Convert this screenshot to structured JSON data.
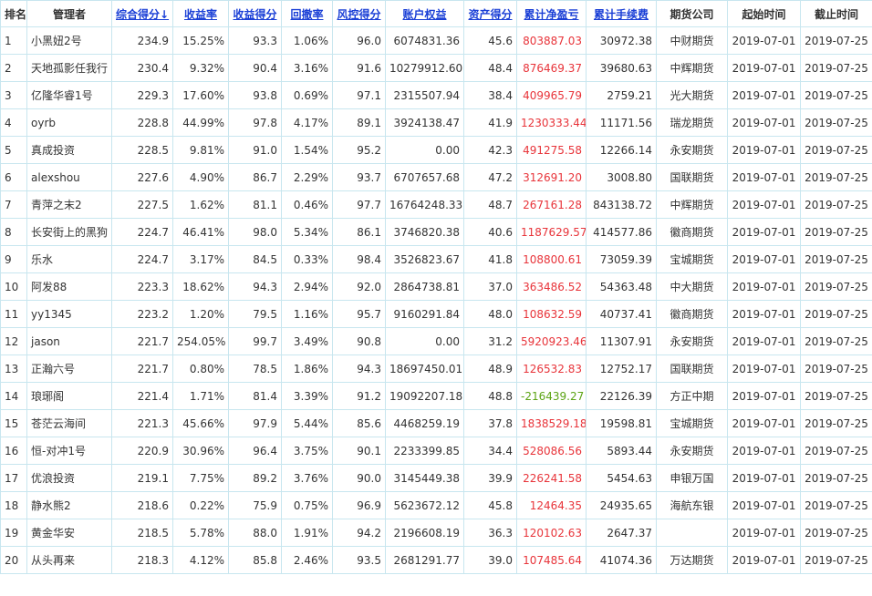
{
  "table": {
    "headers": [
      {
        "key": "rank",
        "label": "排名",
        "sortable": false
      },
      {
        "key": "manager",
        "label": "管理者",
        "sortable": false
      },
      {
        "key": "total_score",
        "label": "综合得分↓",
        "sortable": true
      },
      {
        "key": "return_rate",
        "label": "收益率",
        "sortable": true
      },
      {
        "key": "return_score",
        "label": "收益得分",
        "sortable": true
      },
      {
        "key": "drawdown",
        "label": "回撤率",
        "sortable": true
      },
      {
        "key": "risk_score",
        "label": "风控得分",
        "sortable": true
      },
      {
        "key": "equity",
        "label": "账户权益",
        "sortable": true
      },
      {
        "key": "asset_score",
        "label": "资产得分",
        "sortable": true
      },
      {
        "key": "net_pnl",
        "label": "累计净盈亏",
        "sortable": true
      },
      {
        "key": "fees",
        "label": "累计手续费",
        "sortable": true
      },
      {
        "key": "broker",
        "label": "期货公司",
        "sortable": false
      },
      {
        "key": "start",
        "label": "起始时间",
        "sortable": false
      },
      {
        "key": "end",
        "label": "截止时间",
        "sortable": false
      }
    ],
    "rows": [
      {
        "rank": "1",
        "manager": "小黑妞2号",
        "total_score": "234.9",
        "return_rate": "15.25%",
        "return_score": "93.3",
        "drawdown": "1.06%",
        "risk_score": "96.0",
        "equity": "6074831.36",
        "asset_score": "45.6",
        "net_pnl": "803887.03",
        "fees": "30972.38",
        "broker": "中财期货",
        "start": "2019-07-01",
        "end": "2019-07-25"
      },
      {
        "rank": "2",
        "manager": "天地孤影任我行",
        "total_score": "230.4",
        "return_rate": "9.32%",
        "return_score": "90.4",
        "drawdown": "3.16%",
        "risk_score": "91.6",
        "equity": "10279912.60",
        "asset_score": "48.4",
        "net_pnl": "876469.37",
        "fees": "39680.63",
        "broker": "中辉期货",
        "start": "2019-07-01",
        "end": "2019-07-25"
      },
      {
        "rank": "3",
        "manager": "亿隆华睿1号",
        "total_score": "229.3",
        "return_rate": "17.60%",
        "return_score": "93.8",
        "drawdown": "0.69%",
        "risk_score": "97.1",
        "equity": "2315507.94",
        "asset_score": "38.4",
        "net_pnl": "409965.79",
        "fees": "2759.21",
        "broker": "光大期货",
        "start": "2019-07-01",
        "end": "2019-07-25"
      },
      {
        "rank": "4",
        "manager": "oyrb",
        "total_score": "228.8",
        "return_rate": "44.99%",
        "return_score": "97.8",
        "drawdown": "4.17%",
        "risk_score": "89.1",
        "equity": "3924138.47",
        "asset_score": "41.9",
        "net_pnl": "1230333.44",
        "fees": "11171.56",
        "broker": "瑞龙期货",
        "start": "2019-07-01",
        "end": "2019-07-25"
      },
      {
        "rank": "5",
        "manager": "真成投资",
        "total_score": "228.5",
        "return_rate": "9.81%",
        "return_score": "91.0",
        "drawdown": "1.54%",
        "risk_score": "95.2",
        "equity": "0.00",
        "asset_score": "42.3",
        "net_pnl": "491275.58",
        "fees": "12266.14",
        "broker": "永安期货",
        "start": "2019-07-01",
        "end": "2019-07-25"
      },
      {
        "rank": "6",
        "manager": "alexshou",
        "total_score": "227.6",
        "return_rate": "4.90%",
        "return_score": "86.7",
        "drawdown": "2.29%",
        "risk_score": "93.7",
        "equity": "6707657.68",
        "asset_score": "47.2",
        "net_pnl": "312691.20",
        "fees": "3008.80",
        "broker": "国联期货",
        "start": "2019-07-01",
        "end": "2019-07-25"
      },
      {
        "rank": "7",
        "manager": "青萍之末2",
        "total_score": "227.5",
        "return_rate": "1.62%",
        "return_score": "81.1",
        "drawdown": "0.46%",
        "risk_score": "97.7",
        "equity": "16764248.33",
        "asset_score": "48.7",
        "net_pnl": "267161.28",
        "fees": "843138.72",
        "broker": "中辉期货",
        "start": "2019-07-01",
        "end": "2019-07-25"
      },
      {
        "rank": "8",
        "manager": "长安街上的黑狗",
        "total_score": "224.7",
        "return_rate": "46.41%",
        "return_score": "98.0",
        "drawdown": "5.34%",
        "risk_score": "86.1",
        "equity": "3746820.38",
        "asset_score": "40.6",
        "net_pnl": "1187629.57",
        "fees": "414577.86",
        "broker": "徽商期货",
        "start": "2019-07-01",
        "end": "2019-07-25"
      },
      {
        "rank": "9",
        "manager": "乐水",
        "total_score": "224.7",
        "return_rate": "3.17%",
        "return_score": "84.5",
        "drawdown": "0.33%",
        "risk_score": "98.4",
        "equity": "3526823.67",
        "asset_score": "41.8",
        "net_pnl": "108800.61",
        "fees": "73059.39",
        "broker": "宝城期货",
        "start": "2019-07-01",
        "end": "2019-07-25"
      },
      {
        "rank": "10",
        "manager": "阿发88",
        "total_score": "223.3",
        "return_rate": "18.62%",
        "return_score": "94.3",
        "drawdown": "2.94%",
        "risk_score": "92.0",
        "equity": "2864738.81",
        "asset_score": "37.0",
        "net_pnl": "363486.52",
        "fees": "54363.48",
        "broker": "中大期货",
        "start": "2019-07-01",
        "end": "2019-07-25"
      },
      {
        "rank": "11",
        "manager": "yy1345",
        "total_score": "223.2",
        "return_rate": "1.20%",
        "return_score": "79.5",
        "drawdown": "1.16%",
        "risk_score": "95.7",
        "equity": "9160291.84",
        "asset_score": "48.0",
        "net_pnl": "108632.59",
        "fees": "40737.41",
        "broker": "徽商期货",
        "start": "2019-07-01",
        "end": "2019-07-25"
      },
      {
        "rank": "12",
        "manager": "jason",
        "total_score": "221.7",
        "return_rate": "254.05%",
        "return_score": "99.7",
        "drawdown": "3.49%",
        "risk_score": "90.8",
        "equity": "0.00",
        "asset_score": "31.2",
        "net_pnl": "5920923.46",
        "fees": "11307.91",
        "broker": "永安期货",
        "start": "2019-07-01",
        "end": "2019-07-25"
      },
      {
        "rank": "13",
        "manager": "正瀚六号",
        "total_score": "221.7",
        "return_rate": "0.80%",
        "return_score": "78.5",
        "drawdown": "1.86%",
        "risk_score": "94.3",
        "equity": "18697450.01",
        "asset_score": "48.9",
        "net_pnl": "126532.83",
        "fees": "12752.17",
        "broker": "国联期货",
        "start": "2019-07-01",
        "end": "2019-07-25"
      },
      {
        "rank": "14",
        "manager": "琅琊阁",
        "total_score": "221.4",
        "return_rate": "1.71%",
        "return_score": "81.4",
        "drawdown": "3.39%",
        "risk_score": "91.2",
        "equity": "19092207.18",
        "asset_score": "48.8",
        "net_pnl": "-216439.27",
        "fees": "22126.39",
        "broker": "方正中期",
        "start": "2019-07-01",
        "end": "2019-07-25"
      },
      {
        "rank": "15",
        "manager": "苍茫云海间",
        "total_score": "221.3",
        "return_rate": "45.66%",
        "return_score": "97.9",
        "drawdown": "5.44%",
        "risk_score": "85.6",
        "equity": "4468259.19",
        "asset_score": "37.8",
        "net_pnl": "1838529.18",
        "fees": "19598.81",
        "broker": "宝城期货",
        "start": "2019-07-01",
        "end": "2019-07-25"
      },
      {
        "rank": "16",
        "manager": "恒-对冲1号",
        "total_score": "220.9",
        "return_rate": "30.96%",
        "return_score": "96.4",
        "drawdown": "3.75%",
        "risk_score": "90.1",
        "equity": "2233399.85",
        "asset_score": "34.4",
        "net_pnl": "528086.56",
        "fees": "5893.44",
        "broker": "永安期货",
        "start": "2019-07-01",
        "end": "2019-07-25"
      },
      {
        "rank": "17",
        "manager": "优浪投资",
        "total_score": "219.1",
        "return_rate": "7.75%",
        "return_score": "89.2",
        "drawdown": "3.76%",
        "risk_score": "90.0",
        "equity": "3145449.38",
        "asset_score": "39.9",
        "net_pnl": "226241.58",
        "fees": "5454.63",
        "broker": "申银万国",
        "start": "2019-07-01",
        "end": "2019-07-25"
      },
      {
        "rank": "18",
        "manager": "静水熊2",
        "total_score": "218.6",
        "return_rate": "0.22%",
        "return_score": "75.9",
        "drawdown": "0.75%",
        "risk_score": "96.9",
        "equity": "5623672.12",
        "asset_score": "45.8",
        "net_pnl": "12464.35",
        "fees": "24935.65",
        "broker": "海航东银",
        "start": "2019-07-01",
        "end": "2019-07-25"
      },
      {
        "rank": "19",
        "manager": "黄金华安",
        "total_score": "218.5",
        "return_rate": "5.78%",
        "return_score": "88.0",
        "drawdown": "1.91%",
        "risk_score": "94.2",
        "equity": "2196608.19",
        "asset_score": "36.3",
        "net_pnl": "120102.63",
        "fees": "2647.37",
        "broker": "",
        "start": "2019-07-01",
        "end": "2019-07-25"
      },
      {
        "rank": "20",
        "manager": "从头再来",
        "total_score": "218.3",
        "return_rate": "4.12%",
        "return_score": "85.8",
        "drawdown": "2.46%",
        "risk_score": "93.5",
        "equity": "2681291.77",
        "asset_score": "39.0",
        "net_pnl": "107485.64",
        "fees": "41074.36",
        "broker": "万达期货",
        "start": "2019-07-01",
        "end": "2019-07-25"
      }
    ]
  },
  "colors": {
    "link": "#1a3fd6",
    "positive": "#e8343a",
    "negative": "#5ca415",
    "border": "#c8e6ef"
  }
}
